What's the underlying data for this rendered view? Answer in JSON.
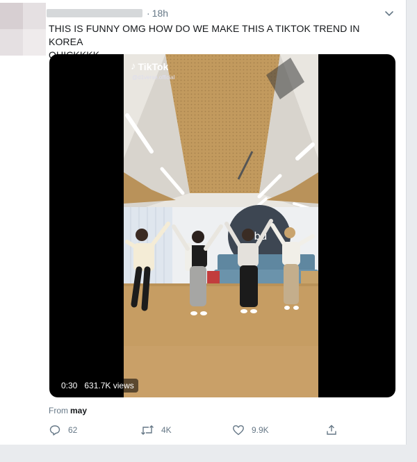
{
  "tweet": {
    "time": "18h",
    "text_line1": "THIS IS FUNNY OMG HOW DO WE MAKE THIS A TIKTOK TREND IN KOREA",
    "text_line2": "QUICKKKK"
  },
  "video": {
    "watermark_brand": "TikTok",
    "watermark_handle": "@d1verse.official",
    "sign_text": "ərbu",
    "duration": "0:30",
    "views": "631.7K views"
  },
  "source": {
    "from_label": "From",
    "from_name": "may"
  },
  "actions": {
    "replies": "62",
    "retweets": "4K",
    "likes": "9.9K"
  },
  "icons": [
    "chevron-down-icon",
    "tiktok-logo-icon",
    "reply-icon",
    "retweet-icon",
    "like-icon",
    "share-icon"
  ],
  "colors": {
    "text": "#14171a",
    "secondary": "#657786",
    "background": "#e9ebee"
  }
}
